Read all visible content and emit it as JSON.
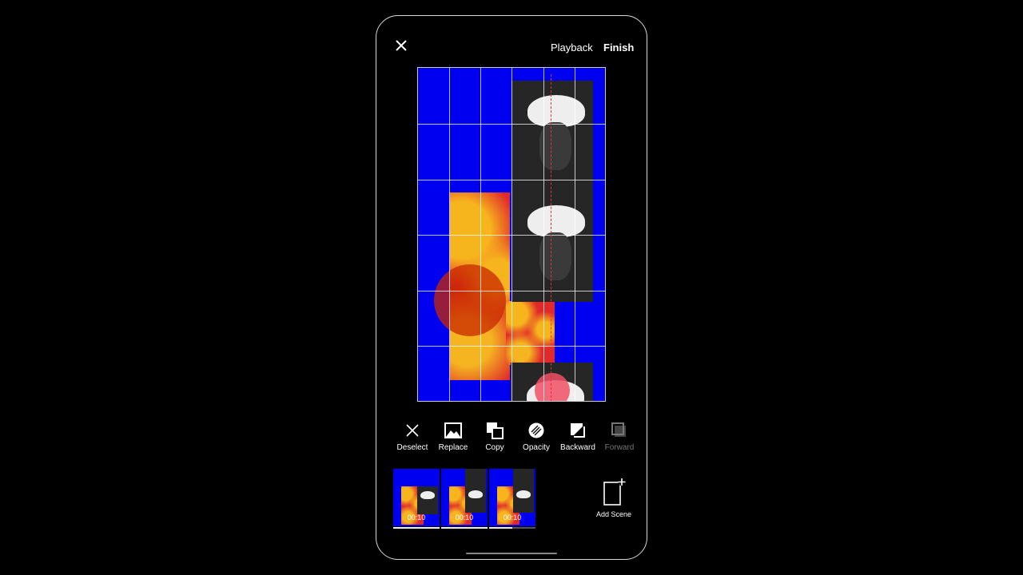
{
  "header": {
    "close_icon": "close-icon",
    "playback_label": "Playback",
    "finish_label": "Finish"
  },
  "colors": {
    "canvas_background": "#0000f0",
    "guide_line": "#e0303a"
  },
  "toolbar": [
    {
      "label": "Deselect",
      "icon": "x-icon"
    },
    {
      "label": "Replace",
      "icon": "image-icon"
    },
    {
      "label": "Copy",
      "icon": "copy-icon"
    },
    {
      "label": "Opacity",
      "icon": "opacity-icon"
    },
    {
      "label": "Backward",
      "icon": "send-backward-icon"
    },
    {
      "label": "Forward",
      "icon": "bring-forward-icon",
      "disabled": true
    }
  ],
  "scenes": [
    {
      "duration": "00:10",
      "progress": 1
    },
    {
      "duration": "00:10",
      "progress": 1
    },
    {
      "duration": "00:10",
      "progress": 0.5
    }
  ],
  "add_scene_label": "Add Scene"
}
